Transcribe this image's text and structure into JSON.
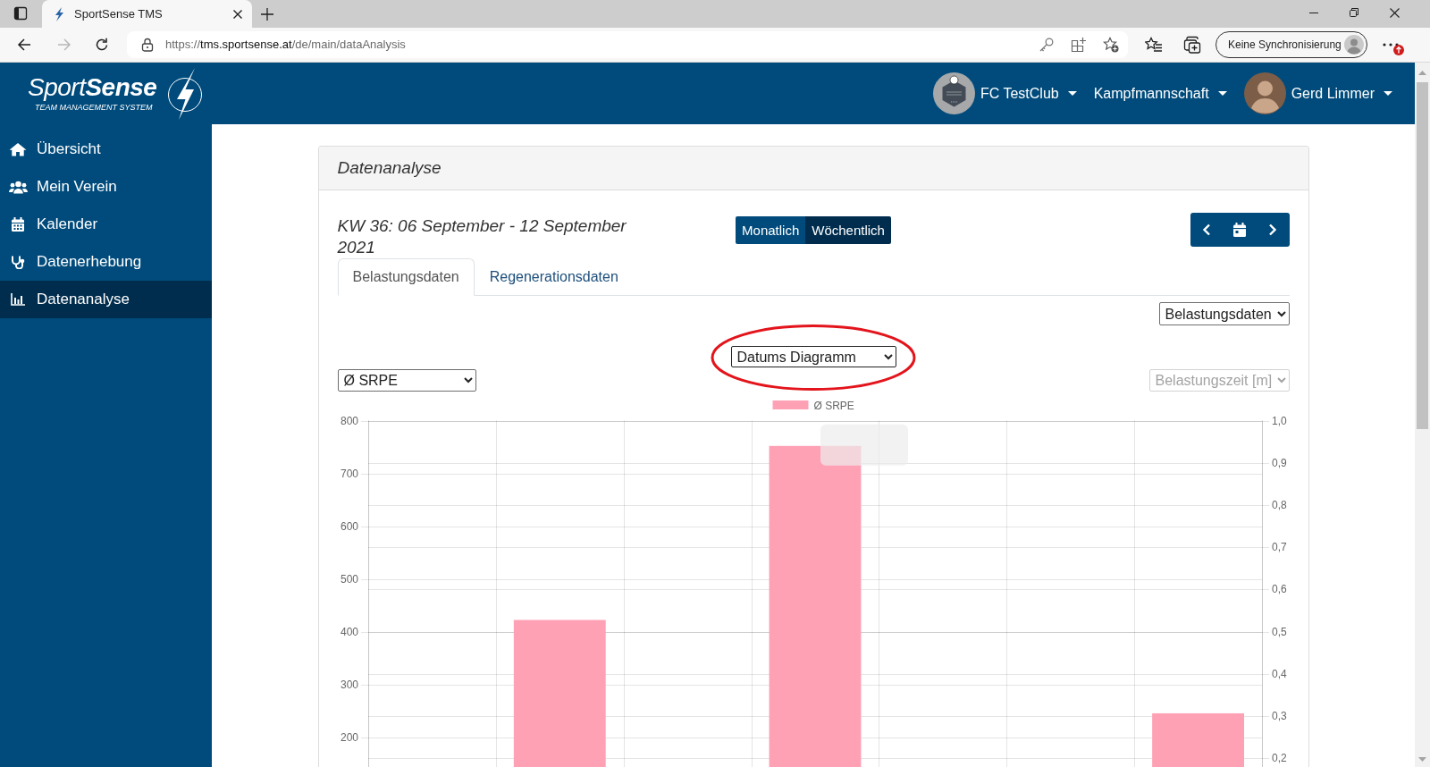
{
  "browser": {
    "tab": {
      "title": "SportSense TMS"
    },
    "forward": {
      "disabled": true
    },
    "address": {
      "scheme": "https://",
      "host": "tms.sportsense.at",
      "path": "/de/main/dataAnalysis"
    },
    "profile": {
      "label": "Keine Synchronisierung"
    }
  },
  "header": {
    "logo": {
      "title": "Sport**Sense**",
      "tagline": "TEAM MANAGEMENT SYSTEM"
    },
    "menus": [
      {
        "kind": "club",
        "label": "FC TestClub"
      },
      {
        "kind": "team",
        "label": "Kampfmannschaft"
      },
      {
        "kind": "user",
        "label": "Gerd Limmer"
      }
    ]
  },
  "sidebar": {
    "items": [
      {
        "label": "Übersicht",
        "selected": false
      },
      {
        "label": "Mein Verein",
        "selected": false
      },
      {
        "label": "Kalender",
        "selected": false
      },
      {
        "label": "Datenerhebung",
        "selected": false
      },
      {
        "label": "Datenanalyse",
        "selected": true
      }
    ]
  },
  "card": {
    "title": "Datenanalyse",
    "period": "KW 36: 06 September - 12 September 2021",
    "view_toggle": [
      {
        "label": "Monatlich",
        "selected": false
      },
      {
        "label": "Wöchentlich",
        "selected": true
      }
    ],
    "tabs": [
      {
        "label": "Belastungsdaten",
        "selected": true
      },
      {
        "label": "Regenerationsdaten",
        "selected": false
      }
    ],
    "data_select": {
      "value": "Belastungsdaten",
      "disabled": false
    },
    "chart_type_select": {
      "value": "Datums Diagramm",
      "disabled": false,
      "highlighted": true
    },
    "metric_select": {
      "value": "Ø SRPE",
      "disabled": false
    },
    "secondary_axis_select": {
      "value": "Belastungszeit [m]",
      "disabled": true
    },
    "chart": {
      "chart_data": {
        "type": "bar",
        "series": [
          {
            "name": "Ø SRPE",
            "color": "#ffa1b5",
            "values": [
              null,
              422,
              null,
              752,
              null,
              null,
              245
            ]
          }
        ],
        "ylim": [
          0,
          800
        ],
        "yticks": [
          200,
          300,
          400,
          500,
          600,
          700,
          800
        ],
        "grid": true
      },
      "right_axis_ticks": [
        "1,0",
        "0,9",
        "0,8",
        "0,7",
        "0,6",
        "0,5",
        "0,4",
        "0,3",
        "0,2"
      ]
    }
  }
}
